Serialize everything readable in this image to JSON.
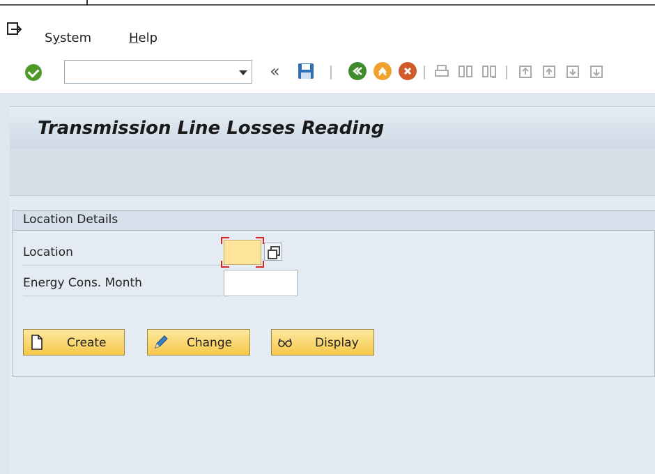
{
  "menu": {
    "items": [
      {
        "label": "System",
        "accel": "y"
      },
      {
        "label": "Help",
        "accel": "H"
      }
    ]
  },
  "toolbar": {
    "command_field_value": "",
    "icons": [
      "enter-icon",
      "command-dropdown-icon",
      "collapse-icon",
      "save-icon",
      "back-icon",
      "exit-icon",
      "cancel-icon",
      "print-icon",
      "find-icon",
      "find-next-icon",
      "first-page-icon",
      "previous-page-icon",
      "next-page-icon",
      "last-page-icon"
    ]
  },
  "screen": {
    "title": "Transmission Line Losses Reading"
  },
  "location_details": {
    "group_title": "Location Details",
    "location_label": "Location",
    "location_value": "",
    "month_label": "Energy Cons. Month",
    "month_value": ""
  },
  "actions": {
    "create": "Create",
    "change": "Change",
    "display": "Display"
  },
  "colors": {
    "required_field": "#fde49a",
    "button_gold": "#f6c849",
    "title_bar": "#cdd9e5",
    "background": "#dfe6ee"
  }
}
